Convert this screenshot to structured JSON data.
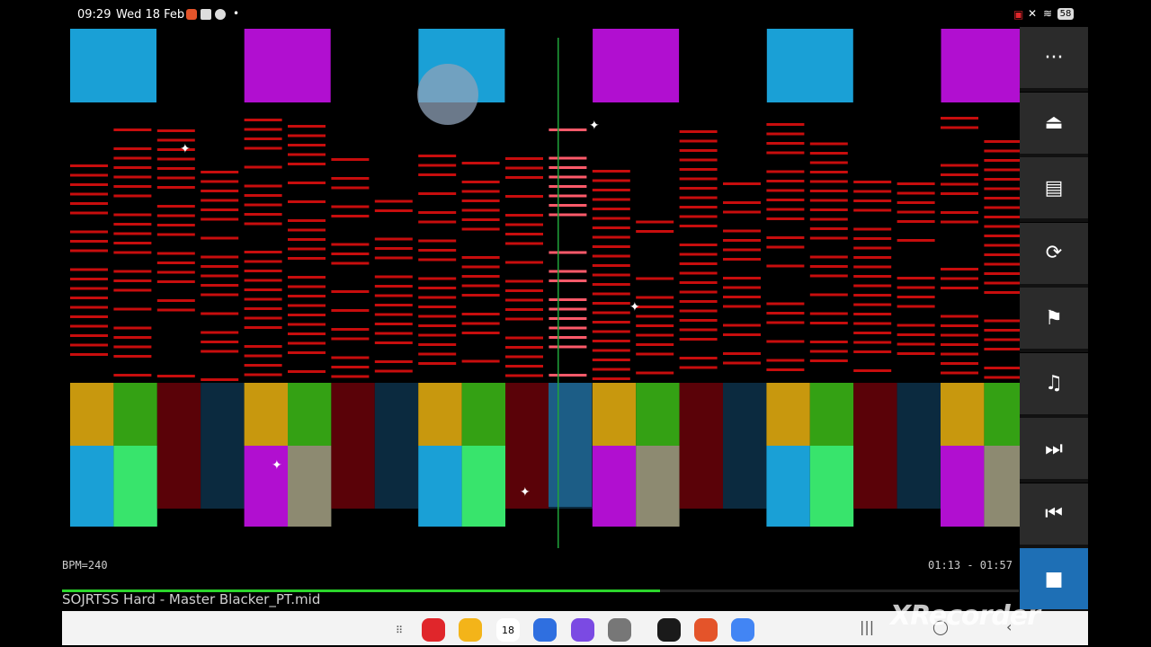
{
  "status_bar": {
    "time": "09:29",
    "date": "Wed 18 Feb",
    "battery": "58"
  },
  "player": {
    "bpm": "BPM=240",
    "timecode": "01:13 - 01:57",
    "filename": "SOJRTSS Hard - Master Blacker_PT.mid",
    "progress": 0.625
  },
  "sidebar": {
    "buttons": [
      {
        "name": "more-icon",
        "glyph": "···"
      },
      {
        "name": "eject-icon",
        "glyph": "⏏"
      },
      {
        "name": "track-list-icon",
        "glyph": "▤"
      },
      {
        "name": "loop-icon",
        "glyph": "⟳"
      },
      {
        "name": "flag-icon",
        "glyph": "⚑"
      },
      {
        "name": "metronome-icon",
        "glyph": "♫"
      },
      {
        "name": "fast-forward-icon",
        "glyph": "⏭"
      },
      {
        "name": "rewind-icon",
        "glyph": "⏮"
      },
      {
        "name": "stop-icon",
        "glyph": "■"
      }
    ]
  },
  "dock": {
    "calendar_day": "18",
    "apps": [
      {
        "name": "apps-grid-icon",
        "color": "#f3f3f3"
      },
      {
        "name": "app-red-icon",
        "color": "#e0262b"
      },
      {
        "name": "files-icon",
        "color": "#f3b419"
      },
      {
        "name": "calendar-icon",
        "color": "#35c1a7"
      },
      {
        "name": "messages-icon",
        "color": "#2f6fe0"
      },
      {
        "name": "notes-icon",
        "color": "#7b4ae3"
      },
      {
        "name": "camera-icon",
        "color": "#777777"
      },
      {
        "name": "midi-app-icon",
        "color": "#1a1a1a"
      },
      {
        "name": "recorder-icon",
        "color": "#e4542a"
      },
      {
        "name": "chrome-icon",
        "color": "#4285f4"
      }
    ]
  },
  "watermark": "XRecorder",
  "colors": {
    "note_red": "#c80d0d",
    "playhead": "#1fa33a",
    "cyan": "#1aa0d6",
    "purple": "#b10fd0",
    "gold": "#c8980e",
    "green": "#34a114",
    "dark_red": "#5a0208",
    "navy": "#0b2a3f",
    "light_green": "#38e46c",
    "tan": "#8d8a71"
  }
}
